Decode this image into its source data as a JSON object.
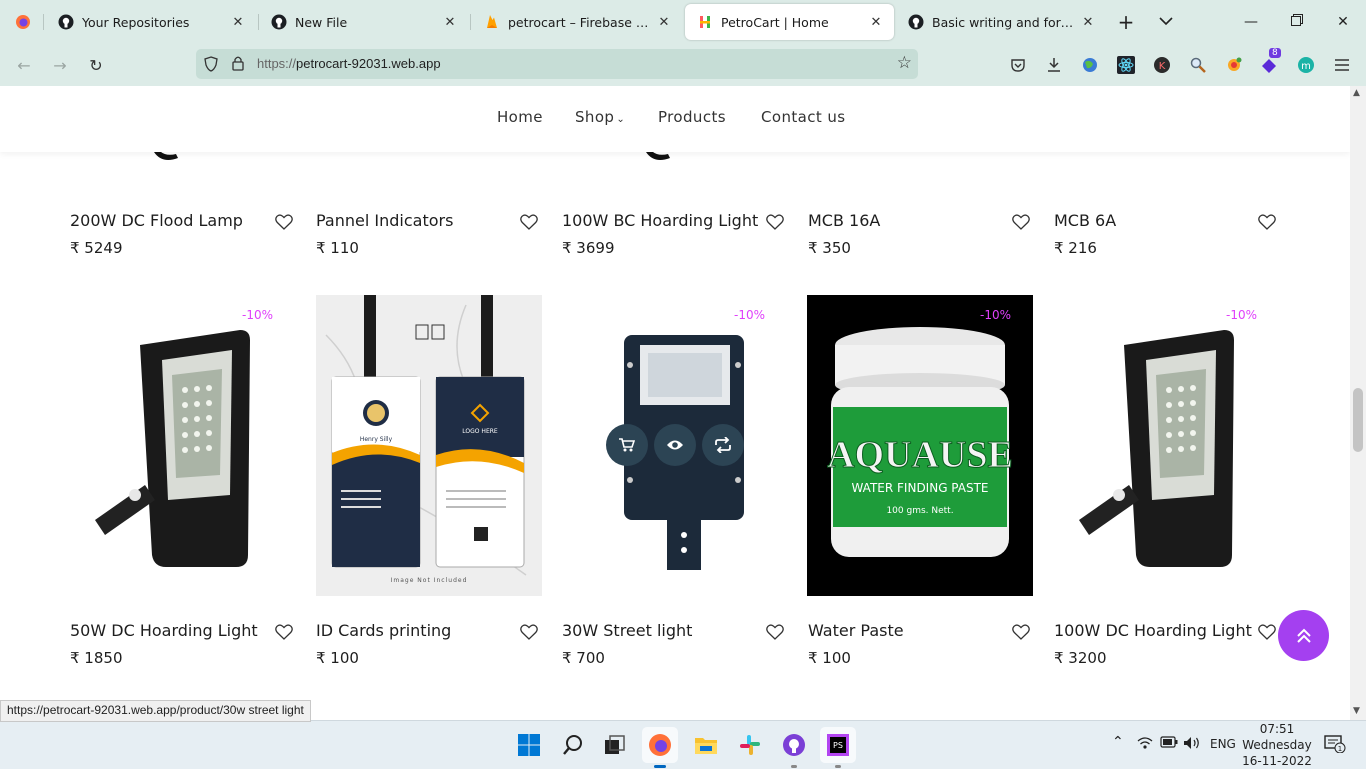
{
  "browser": {
    "tabs": [
      {
        "label": "Your Repositories",
        "icon": "github-icon"
      },
      {
        "label": "New File",
        "icon": "github-icon"
      },
      {
        "label": "petrocart – Firebase console",
        "icon": "firebase-icon"
      },
      {
        "label": "PetroCart | Home",
        "icon": "petrocart-favicon",
        "active": true
      },
      {
        "label": "Basic writing and formatting",
        "icon": "github-icon"
      }
    ],
    "url_protocol": "https://",
    "url_host": "petrocart-92031.web.app",
    "extension_badge": "8"
  },
  "site": {
    "nav": [
      {
        "label": "Home"
      },
      {
        "label": "Shop"
      },
      {
        "label": "Products"
      },
      {
        "label": "Contact us"
      }
    ],
    "currency_symbol": "₹",
    "row1": [
      {
        "name": "200W DC Flood Lamp",
        "price": "₹ 5249"
      },
      {
        "name": "Pannel Indicators",
        "price": "₹ 110"
      },
      {
        "name": "100W BC Hoarding Light",
        "price": "₹ 3699"
      },
      {
        "name": "MCB 16A",
        "price": "₹ 350"
      },
      {
        "name": "MCB 6A",
        "price": "₹ 216"
      }
    ],
    "row2": [
      {
        "name": "50W DC Hoarding Light",
        "price": "₹ 1850",
        "discount": "-10%"
      },
      {
        "name": "ID Cards printing",
        "price": "₹ 100",
        "discount": ""
      },
      {
        "name": "30W Street light",
        "price": "₹ 700",
        "discount": "-10%"
      },
      {
        "name": "Water Paste",
        "price": "₹ 100",
        "discount": "-10%"
      },
      {
        "name": "100W DC Hoarding Light",
        "price": "₹ 3200",
        "discount": "-10%"
      }
    ],
    "id_card": {
      "logo_text": "LOGO HERE",
      "person_name": "Henry Silly",
      "footer_note": "Image Not Included"
    },
    "water_paste": {
      "brand": "AQUAUSE",
      "subtitle": "WATER FINDING PASTE",
      "weight": "100 gms. Nett."
    }
  },
  "status_link": "https://petrocart-92031.web.app/product/30w street light",
  "taskbar": {
    "language": "ENG",
    "time": "07:51",
    "day": "Wednesday",
    "date": "16-11-2022"
  },
  "colors": {
    "tabbar_bg": "#dcebe7",
    "discount": "#e040fb",
    "scroll_top_button": "#a440f0",
    "quick_action": "#2c4454"
  }
}
